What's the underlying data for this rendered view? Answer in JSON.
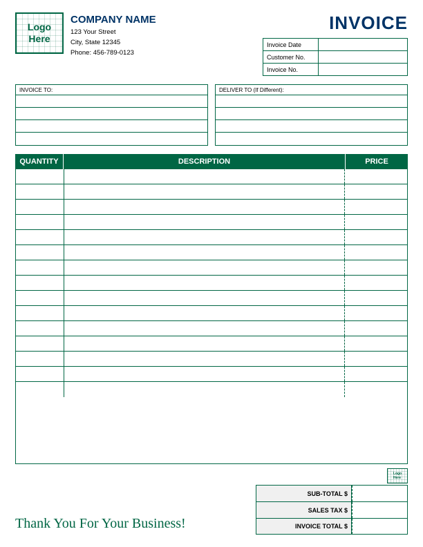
{
  "header": {
    "logo_text_line1": "Logo",
    "logo_text_line2": "Here",
    "company_name": "COMPANY NAME",
    "address_line1": "123 Your Street",
    "address_line2": "City, State 12345",
    "phone": "Phone: 456-789-0123",
    "invoice_title": "INVOICE",
    "fields": [
      {
        "label": "Invoice Date",
        "value": ""
      },
      {
        "label": "Customer No.",
        "value": ""
      },
      {
        "label": "Invoice No.",
        "value": ""
      }
    ]
  },
  "address_section": {
    "invoice_to_label": "INVOICE TO:",
    "deliver_to_label": "DELIVER TO (If Different):"
  },
  "table": {
    "col_qty": "QUANTITY",
    "col_desc": "DESCRIPTION",
    "col_price": "PRICE",
    "rows": [
      {},
      {},
      {},
      {},
      {},
      {},
      {},
      {},
      {},
      {},
      {},
      {},
      {},
      {},
      {}
    ]
  },
  "totals": {
    "subtotal_label": "SUB-TOTAL $",
    "salestax_label": "SALES TAX $",
    "invoicetotal_label": "INVOICE TOTAL $"
  },
  "footer": {
    "thank_you": "Thank You For Your Business!"
  }
}
